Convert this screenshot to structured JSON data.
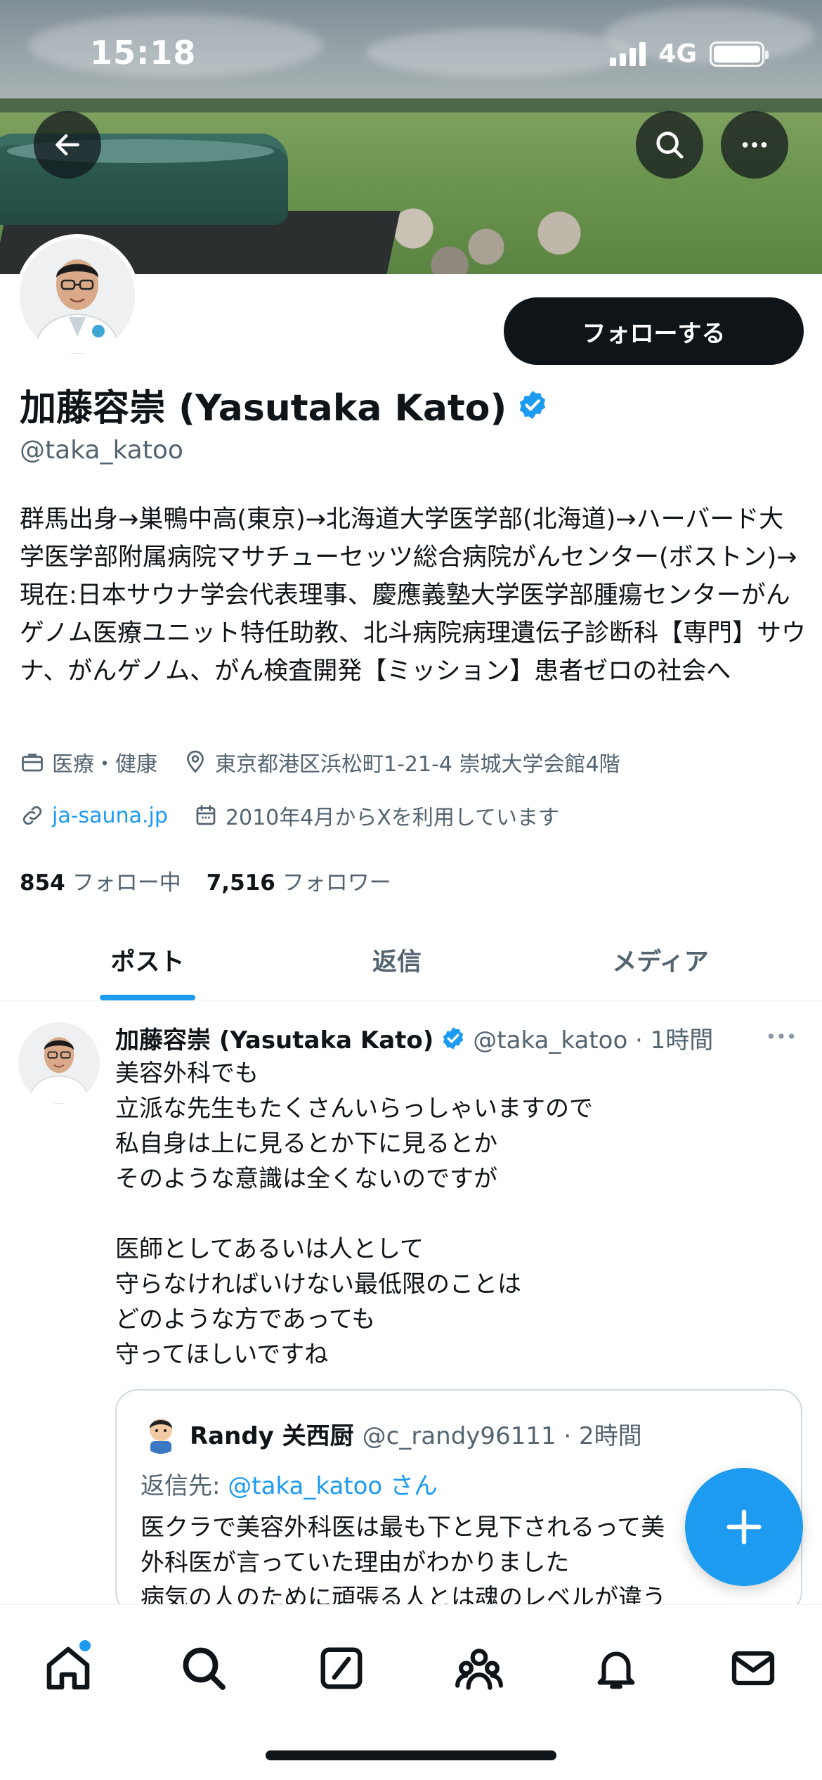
{
  "status_bar": {
    "time": "15:18",
    "network": "4G"
  },
  "profile": {
    "name": "加藤容崇 (Yasutaka Kato)",
    "handle": "@taka_katoo",
    "follow_label": "フォローする",
    "bio": "群馬出身→巣鴨中高(東京)→北海道大学医学部(北海道)→ハーバード大学医学部附属病院マサチューセッツ総合病院がんセンター(ボストン)→現在:日本サウナ学会代表理事、慶應義塾大学医学部腫瘍センターがんゲノム医療ユニット特任助教、北斗病院病理遺伝子診断科【専門】サウナ、がんゲノム、がん検査開発【ミッション】患者ゼロの社会へ",
    "category": "医療・健康",
    "location": "東京都港区浜松町1-21-4 崇城大学会館4階",
    "website": "ja-sauna.jp",
    "joined": "2010年4月からXを利用しています",
    "following_count": "854",
    "following_label": "フォロー中",
    "followers_count": "7,516",
    "followers_label": "フォロワー"
  },
  "tabs": [
    {
      "label": "ポスト",
      "active": true
    },
    {
      "label": "返信",
      "active": false
    },
    {
      "label": "メディア",
      "active": false
    }
  ],
  "post": {
    "author_name": "加藤容崇 (Yasutaka Kato)",
    "meta": "@taka_katoo · 1時間",
    "body": "美容外科でも\n立派な先生もたくさんいらっしゃいますので\n私自身は上に見るとか下に見るとか\nそのような意識は全くないのですが\n\n医師としてあるいは人として\n守らなければいけない最低限のことは\nどのような方であっても\n守ってほしいですね",
    "quote": {
      "author_name": "Randy 关西厨",
      "meta": "@c_randy96111 · 2時間",
      "reply_prefix": "返信先: ",
      "reply_mention": "@taka_katoo",
      "reply_suffix": " さん",
      "body": "医クラで美容外科医は最も下と見下されるって美\n外科医が言っていた理由がわかりました\n病気の人のために頑張る人とは魂のレベルが違う"
    }
  },
  "colors": {
    "accent": "#1d9bf0",
    "text_primary": "#0f1419",
    "text_secondary": "#536471"
  },
  "icons": [
    "back-arrow-icon",
    "search-icon",
    "more-icon",
    "verified-badge-icon",
    "briefcase-icon",
    "location-pin-icon",
    "link-icon",
    "calendar-icon",
    "plus-icon",
    "home-icon",
    "compose-icon",
    "communities-icon",
    "bell-icon",
    "mail-icon"
  ]
}
